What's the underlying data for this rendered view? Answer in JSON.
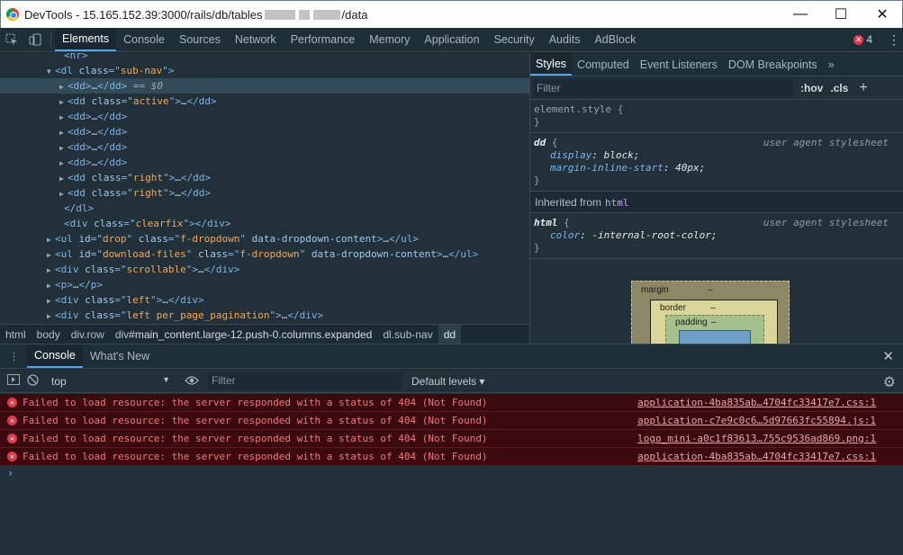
{
  "window": {
    "title_prefix": "DevTools - 15.165.152.39:3000/rails/db/tables",
    "title_suffix": "/data"
  },
  "main_tabs": [
    "Elements",
    "Console",
    "Sources",
    "Network",
    "Performance",
    "Memory",
    "Application",
    "Security",
    "Audits",
    "AdBlock"
  ],
  "error_count": "4",
  "elements": {
    "lines": [
      {
        "indent": 62,
        "tri": "",
        "html": [
          [
            "tag",
            "<hr>"
          ]
        ]
      },
      {
        "indent": 52,
        "tri": "▼",
        "html": [
          [
            "tag",
            "<dl "
          ],
          [
            "attr",
            "class"
          ],
          [
            "tag",
            "=\""
          ],
          [
            "val",
            "sub-nav"
          ],
          [
            "tag",
            "\">"
          ]
        ]
      },
      {
        "indent": 66,
        "tri": "▶",
        "html": [
          [
            "tag",
            "<dd>"
          ],
          [
            "plain",
            "…"
          ],
          [
            "tag",
            "</dd>"
          ]
        ],
        "selected": true,
        "suffix": " == $0"
      },
      {
        "indent": 66,
        "tri": "▶",
        "html": [
          [
            "tag",
            "<dd "
          ],
          [
            "attr",
            "class"
          ],
          [
            "tag",
            "=\""
          ],
          [
            "val",
            "active"
          ],
          [
            "tag",
            "\">"
          ],
          [
            "plain",
            "…"
          ],
          [
            "tag",
            "</dd>"
          ]
        ]
      },
      {
        "indent": 66,
        "tri": "▶",
        "html": [
          [
            "tag",
            "<dd>"
          ],
          [
            "plain",
            "…"
          ],
          [
            "tag",
            "</dd>"
          ]
        ]
      },
      {
        "indent": 66,
        "tri": "▶",
        "html": [
          [
            "tag",
            "<dd>"
          ],
          [
            "plain",
            "…"
          ],
          [
            "tag",
            "</dd>"
          ]
        ]
      },
      {
        "indent": 66,
        "tri": "▶",
        "html": [
          [
            "tag",
            "<dd>"
          ],
          [
            "plain",
            "…"
          ],
          [
            "tag",
            "</dd>"
          ]
        ]
      },
      {
        "indent": 66,
        "tri": "▶",
        "html": [
          [
            "tag",
            "<dd>"
          ],
          [
            "plain",
            "…"
          ],
          [
            "tag",
            "</dd>"
          ]
        ]
      },
      {
        "indent": 66,
        "tri": "▶",
        "html": [
          [
            "tag",
            "<dd "
          ],
          [
            "attr",
            "class"
          ],
          [
            "tag",
            "=\""
          ],
          [
            "val",
            "right"
          ],
          [
            "tag",
            "\">"
          ],
          [
            "plain",
            "…"
          ],
          [
            "tag",
            "</dd>"
          ]
        ]
      },
      {
        "indent": 66,
        "tri": "▶",
        "html": [
          [
            "tag",
            "<dd "
          ],
          [
            "attr",
            "class"
          ],
          [
            "tag",
            "=\""
          ],
          [
            "val",
            "right"
          ],
          [
            "tag",
            "\">"
          ],
          [
            "plain",
            "…"
          ],
          [
            "tag",
            "</dd>"
          ]
        ]
      },
      {
        "indent": 62,
        "tri": "",
        "html": [
          [
            "tag",
            "</dl>"
          ]
        ]
      },
      {
        "indent": 62,
        "tri": "",
        "html": [
          [
            "tag",
            "<div "
          ],
          [
            "attr",
            "class"
          ],
          [
            "tag",
            "=\""
          ],
          [
            "val",
            "clearfix"
          ],
          [
            "tag",
            "\">"
          ],
          [
            "tag",
            "</div>"
          ]
        ]
      },
      {
        "indent": 52,
        "tri": "▶",
        "html": [
          [
            "tag",
            "<ul "
          ],
          [
            "attr",
            "id"
          ],
          [
            "tag",
            "=\""
          ],
          [
            "val",
            "drop"
          ],
          [
            "tag",
            "\" "
          ],
          [
            "attr",
            "class"
          ],
          [
            "tag",
            "=\""
          ],
          [
            "val",
            "f-dropdown"
          ],
          [
            "tag",
            "\" "
          ],
          [
            "attr",
            "data-dropdown-content"
          ],
          [
            "tag",
            ">"
          ],
          [
            "plain",
            "…"
          ],
          [
            "tag",
            "</ul>"
          ]
        ]
      },
      {
        "indent": 52,
        "tri": "▶",
        "html": [
          [
            "tag",
            "<ul "
          ],
          [
            "attr",
            "id"
          ],
          [
            "tag",
            "=\""
          ],
          [
            "val",
            "download-files"
          ],
          [
            "tag",
            "\" "
          ],
          [
            "attr",
            "class"
          ],
          [
            "tag",
            "=\""
          ],
          [
            "val",
            "f-dropdown"
          ],
          [
            "tag",
            "\" "
          ],
          [
            "attr",
            "data-dropdown-content"
          ],
          [
            "tag",
            ">"
          ],
          [
            "plain",
            "…"
          ],
          [
            "tag",
            "</ul>"
          ]
        ]
      },
      {
        "indent": 52,
        "tri": "▶",
        "html": [
          [
            "tag",
            "<div "
          ],
          [
            "attr",
            "class"
          ],
          [
            "tag",
            "=\""
          ],
          [
            "val",
            "scrollable"
          ],
          [
            "tag",
            "\">"
          ],
          [
            "plain",
            "…"
          ],
          [
            "tag",
            "</div>"
          ]
        ]
      },
      {
        "indent": 52,
        "tri": "▶",
        "html": [
          [
            "tag",
            "<p>"
          ],
          [
            "plain",
            "…"
          ],
          [
            "tag",
            "</p>"
          ]
        ]
      },
      {
        "indent": 52,
        "tri": "▶",
        "html": [
          [
            "tag",
            "<div "
          ],
          [
            "attr",
            "class"
          ],
          [
            "tag",
            "=\""
          ],
          [
            "val",
            "left"
          ],
          [
            "tag",
            "\">"
          ],
          [
            "plain",
            "…"
          ],
          [
            "tag",
            "</div>"
          ]
        ]
      },
      {
        "indent": 52,
        "tri": "▶",
        "html": [
          [
            "tag",
            "<div "
          ],
          [
            "attr",
            "class"
          ],
          [
            "tag",
            "=\""
          ],
          [
            "val",
            "left per_page_pagination"
          ],
          [
            "tag",
            "\">"
          ],
          [
            "plain",
            "…"
          ],
          [
            "tag",
            "</div>"
          ]
        ]
      }
    ],
    "breadcrumbs": [
      {
        "label": "html"
      },
      {
        "label": "body"
      },
      {
        "label": "div.row"
      },
      {
        "label": "div",
        "hash": "#main_content.large-12.push-0.columns.expanded"
      },
      {
        "label": "dl.sub-nav"
      },
      {
        "label": "dd",
        "active": true
      }
    ]
  },
  "styles": {
    "tabs": [
      "Styles",
      "Computed",
      "Event Listeners",
      "DOM Breakpoints"
    ],
    "filter_placeholder": "Filter",
    "hov": ":hov",
    "cls": ".cls",
    "element_style": "element.style {",
    "dd_selector": "dd",
    "dd_origin": "user agent stylesheet",
    "dd_props": [
      {
        "name": "display",
        "value": "block;"
      },
      {
        "name": "margin-inline-start",
        "value": "40px;"
      }
    ],
    "inherited_label": "Inherited from",
    "inherited_tag": "html",
    "html_selector": "html",
    "html_origin": "user agent stylesheet",
    "html_props": [
      {
        "name": "color",
        "value": "-internal-root-color;"
      }
    ],
    "box_model": {
      "margin": "margin",
      "border": "border",
      "padding": "padding",
      "dash": "–"
    }
  },
  "drawer": {
    "tabs": [
      "Console",
      "What's New"
    ],
    "context": "top",
    "filter_placeholder": "Filter",
    "levels": "Default levels ▾",
    "messages": [
      {
        "text": "Failed to load resource: the server responded with a status of 404 (Not Found)",
        "source": "application-4ba835ab…4704fc33417e7.css:1"
      },
      {
        "text": "Failed to load resource: the server responded with a status of 404 (Not Found)",
        "source": "application-c7e9c0c6…5d97663fc55894.js:1"
      },
      {
        "text": "Failed to load resource: the server responded with a status of 404 (Not Found)",
        "source": "logo_mini-a0c1f83613…755c9536ad869.png:1"
      },
      {
        "text": "Failed to load resource: the server responded with a status of 404 (Not Found)",
        "source": "application-4ba835ab…4704fc33417e7.css:1"
      }
    ]
  }
}
